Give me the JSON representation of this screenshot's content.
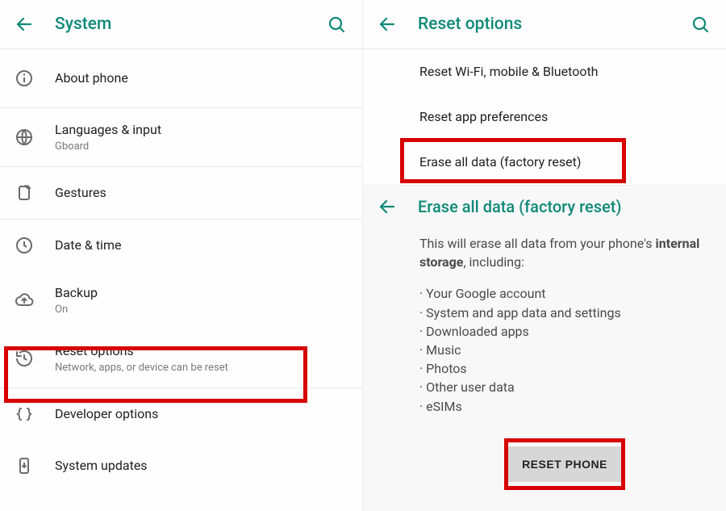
{
  "left": {
    "title": "System",
    "items": [
      {
        "title": "About phone",
        "sub": ""
      },
      {
        "title": "Languages & input",
        "sub": "Gboard"
      },
      {
        "title": "Gestures",
        "sub": ""
      },
      {
        "title": "Date & time",
        "sub": ""
      },
      {
        "title": "Backup",
        "sub": "On"
      },
      {
        "title": "Reset options",
        "sub": "Network, apps, or device can be reset"
      },
      {
        "title": "Developer options",
        "sub": ""
      },
      {
        "title": "System updates",
        "sub": ""
      }
    ]
  },
  "right": {
    "title": "Reset options",
    "items": [
      {
        "title": "Reset Wi-Fi, mobile & Bluetooth"
      },
      {
        "title": "Reset app preferences"
      },
      {
        "title": "Erase all data (factory reset)"
      }
    ],
    "erase": {
      "title": "Erase all data (factory reset)",
      "intro_prefix": "This will erase all data from your phone's ",
      "intro_bold": "internal storage",
      "intro_suffix": ", including:",
      "bullets": [
        "Your Google account",
        "System and app data and settings",
        "Downloaded apps",
        "Music",
        "Photos",
        "Other user data",
        "eSIMs"
      ],
      "button": "RESET PHONE"
    }
  },
  "colors": {
    "accent": "#0f8978",
    "highlight": "#d60000"
  }
}
